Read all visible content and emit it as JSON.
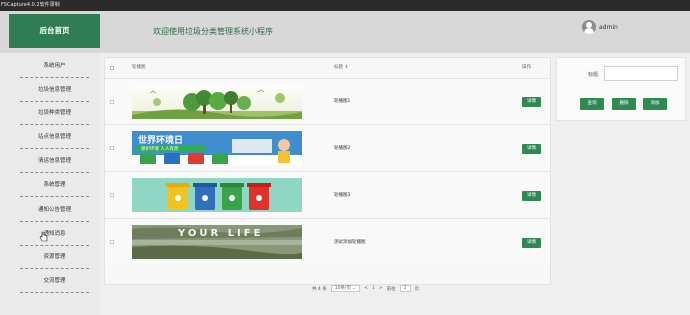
{
  "window": {
    "capture_title": "FSCapture4.0.2软件录制"
  },
  "header": {
    "brand": "后台首页",
    "title": "欢迎使用垃圾分类管理系统小程序",
    "username": "admin"
  },
  "sidebar": {
    "items": [
      {
        "label": "系统用户"
      },
      {
        "label": "垃圾信息管理"
      },
      {
        "label": "垃圾种类管理"
      },
      {
        "label": "站点信息管理"
      },
      {
        "label": "清运信息管理"
      },
      {
        "label": "系统管理"
      },
      {
        "label": "通知公告管理"
      },
      {
        "label": "通知消息"
      },
      {
        "label": "资源管理"
      },
      {
        "label": "交流管理"
      }
    ]
  },
  "table": {
    "columns": {
      "image": "轮播图",
      "title": "标题",
      "ops": "操作"
    },
    "rows": [
      {
        "title": "轮播图1",
        "action": "详情"
      },
      {
        "title": "轮播图2",
        "action": "详情",
        "banner_text": "世界环境日",
        "banner_sub": "保护环境 人人有责"
      },
      {
        "title": "轮播图3",
        "action": "详情"
      },
      {
        "title": "测试添加轮播图",
        "action": "详情",
        "banner_text": "YOUR LIFE"
      }
    ]
  },
  "pagination": {
    "total": "共 4 条",
    "page_size": "10条/页",
    "prev": "<",
    "page": "1",
    "next": ">",
    "goto_label": "前往",
    "goto_value": "1",
    "goto_suffix": "页"
  },
  "search": {
    "label": "标题",
    "value": ""
  },
  "actions": {
    "query": "查询",
    "delete": "删除",
    "add": "添加"
  },
  "colors": {
    "brand": "#2f7d52",
    "accent": "#2f8a52"
  }
}
